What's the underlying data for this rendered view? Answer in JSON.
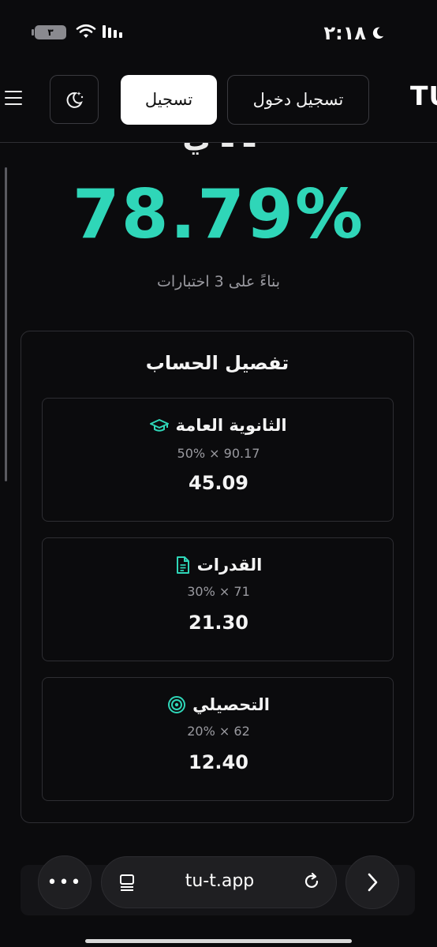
{
  "status_bar": {
    "time": "٢:١٨",
    "battery": "٣"
  },
  "header": {
    "logo": "TU",
    "login_label": "تسجيل دخول",
    "signup_label": "تسجيل",
    "partial_heading": "ـ ـ ي"
  },
  "result": {
    "percentage": "78.79%",
    "based_on": "بناءً على 3 اختبارات",
    "accent_color": "#2fd6b8"
  },
  "breakdown": {
    "title": "تفصيل الحساب",
    "items": [
      {
        "label": "الثانوية العامة",
        "icon": "graduation-cap-icon",
        "formula": "50% × 90.17",
        "value": "45.09"
      },
      {
        "label": "القدرات",
        "icon": "document-icon",
        "formula": "30% × 71",
        "value": "21.30"
      },
      {
        "label": "التحصيلي",
        "icon": "target-icon",
        "formula": "20% × 62",
        "value": "12.40"
      }
    ]
  },
  "browser": {
    "url": "tu-t.app",
    "more_label": "•••"
  }
}
